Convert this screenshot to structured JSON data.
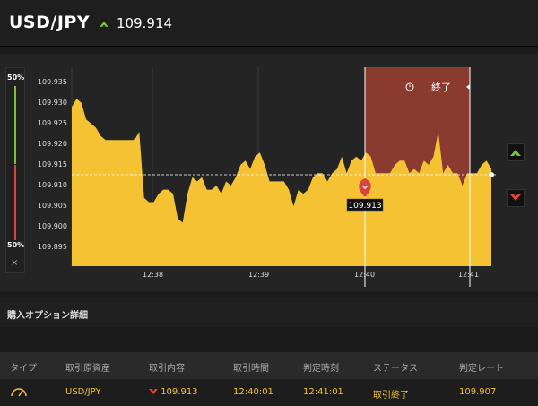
{
  "header": {
    "pair": "USD/JPY",
    "price": "109.914",
    "direction": "up",
    "up_color": "#7bbf3a"
  },
  "gauge": {
    "top_label": "50%",
    "bottom_label": "50%",
    "close_symbol": "×"
  },
  "chart": {
    "expiry_label": "終了",
    "entry_rate_label": "109.913",
    "y_ticks": [
      "109.935",
      "109.930",
      "109.925",
      "109.920",
      "109.915",
      "109.910",
      "109.905",
      "109.900",
      "109.895"
    ],
    "x_ticks": [
      "12:38",
      "12:39",
      "12:40",
      "12:41"
    ],
    "fill_color": "#f5c233",
    "band_color": "#8b3a30"
  },
  "chart_data": {
    "type": "area",
    "xlabel": "",
    "ylabel": "",
    "ylim": [
      109.8905,
      109.9386
    ],
    "reference_line": 109.9134,
    "entry_time": "12:40:01",
    "expiry_time": "12:41:01",
    "series": [
      {
        "values": [
          109.929,
          109.931,
          109.93,
          109.926,
          109.925,
          109.924,
          109.922,
          109.921,
          109.921,
          109.921,
          109.921,
          109.921,
          109.921,
          109.921,
          109.923,
          109.907,
          109.906,
          109.906,
          109.908,
          109.909,
          109.909,
          109.908,
          109.902,
          109.901,
          109.908,
          109.912,
          109.911,
          109.912,
          109.909,
          109.909,
          109.91,
          109.908,
          109.911,
          109.91,
          109.912,
          109.915,
          109.916,
          109.914,
          109.917,
          109.918,
          109.915,
          109.911,
          109.911,
          109.911,
          109.911,
          109.909,
          109.905,
          109.909,
          109.908,
          109.909,
          109.912,
          109.913,
          109.913,
          109.911,
          109.913,
          109.914,
          109.917,
          109.913,
          109.916,
          109.917,
          109.916,
          109.918,
          109.917,
          109.913,
          109.913,
          109.913,
          109.913,
          109.915,
          109.916,
          109.916,
          109.913,
          109.914,
          109.913,
          109.916,
          109.915,
          109.917,
          109.923,
          109.913,
          109.915,
          109.913,
          109.913,
          109.91,
          109.913,
          109.913,
          109.913,
          109.915,
          109.916,
          109.914
        ]
      }
    ]
  },
  "section": {
    "title": "購入オプション詳細"
  },
  "table": {
    "headers": [
      "タイプ",
      "取引原資産",
      "取引内容",
      "取引時間",
      "判定時刻",
      "ステータス",
      "判定レート"
    ],
    "row": {
      "asset": "USD/JPY",
      "rate": "109.913",
      "trade_time": "12:40:01",
      "judge_time": "12:41:01",
      "status": "取引終了",
      "judge_rate": "109.907"
    }
  }
}
